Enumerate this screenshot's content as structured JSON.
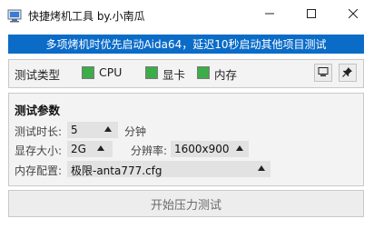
{
  "window": {
    "title": "快捷烤机工具 by.小南瓜",
    "minimize_icon": "minimize-icon",
    "maximize_icon": "maximize-icon",
    "close_icon": "close-icon"
  },
  "banner": {
    "text": "多项烤机时优先启动Aida64，延迟10秒启动其他项目测试",
    "background": "#0b6cc8"
  },
  "test_type": {
    "label": "测试类型",
    "options": [
      {
        "label": "CPU",
        "checked": true
      },
      {
        "label": "显卡",
        "checked": true
      },
      {
        "label": "内存",
        "checked": true
      }
    ],
    "check_color": "#3cad48",
    "tools": [
      "monitor-icon",
      "pin-icon"
    ]
  },
  "params": {
    "title": "测试参数",
    "duration": {
      "label": "测试时长:",
      "value": "5",
      "unit": "分钟"
    },
    "vram": {
      "label": "显存大小:",
      "value": "2G"
    },
    "resolution": {
      "label": "分辨率:",
      "value": "1600x900"
    },
    "memory_config": {
      "label": "内存配置:",
      "value": "极限-anta777.cfg"
    }
  },
  "start_button": {
    "label": "开始压力测试"
  }
}
